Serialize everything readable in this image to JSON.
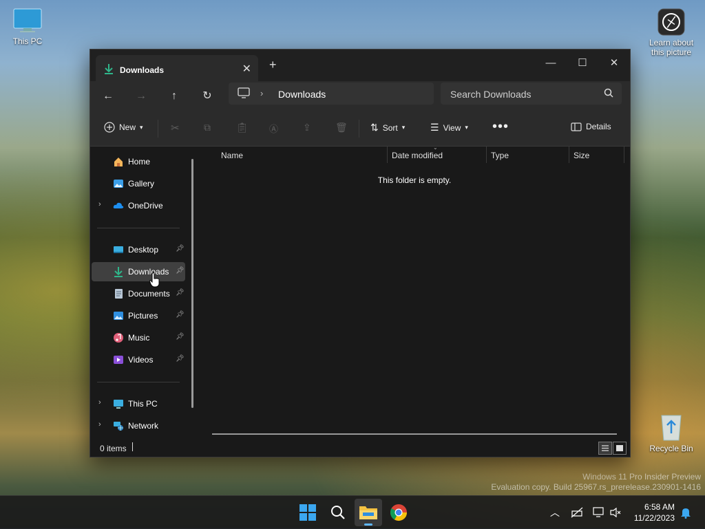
{
  "desktop": {
    "this_pc_label": "This PC",
    "learn_label": "Learn about this picture",
    "recycle_label": "Recycle Bin",
    "watermark_line1": "Windows 11 Pro Insider Preview",
    "watermark_line2": "Evaluation copy. Build 25967.rs_prerelease.230901-1416"
  },
  "window": {
    "tab_title": "Downloads",
    "address_crumb": "Downloads",
    "search_placeholder": "Search Downloads",
    "toolbar": {
      "new_label": "New",
      "sort_label": "Sort",
      "view_label": "View",
      "details_label": "Details"
    },
    "sidebar": {
      "home": "Home",
      "gallery": "Gallery",
      "onedrive": "OneDrive",
      "desktop": "Desktop",
      "downloads": "Downloads",
      "documents": "Documents",
      "pictures": "Pictures",
      "music": "Music",
      "videos": "Videos",
      "thispc": "This PC",
      "network": "Network"
    },
    "columns": [
      "Name",
      "Date modified",
      "Type",
      "Size"
    ],
    "empty_message": "This folder is empty.",
    "status_count": "0 items"
  },
  "taskbar": {
    "time": "6:58 AM",
    "date": "11/22/2023"
  },
  "colors": {
    "accent": "#0078d4",
    "download_green": "#2fb58a",
    "window_bg": "#191919"
  }
}
